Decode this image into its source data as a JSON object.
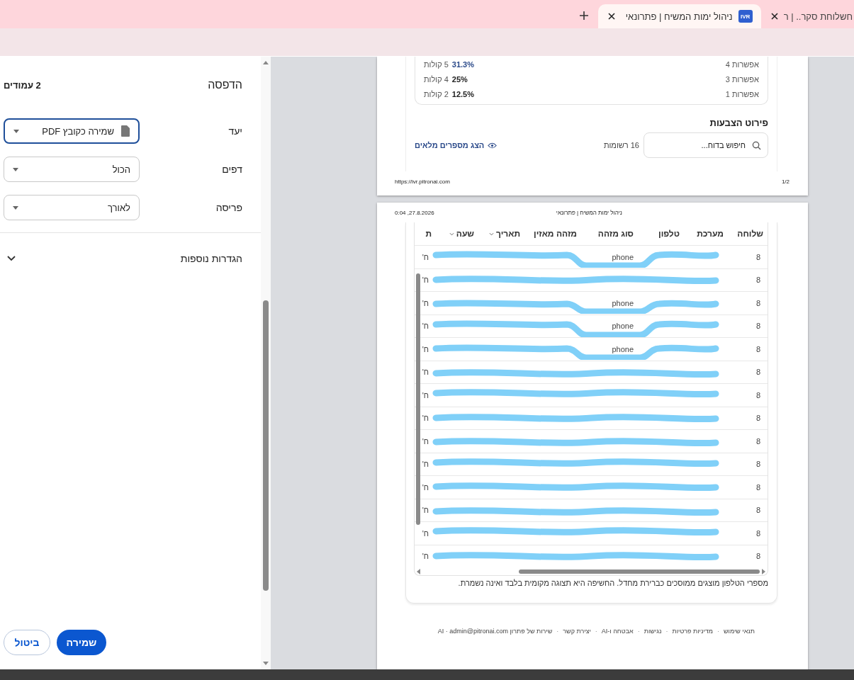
{
  "browser": {
    "tabs": [
      {
        "title": "חשלוחת סקר.. | ר",
        "selected": false
      },
      {
        "title": "ניהול ימות המשיח | פתרונאי",
        "favicon": "IVR",
        "selected": true
      }
    ]
  },
  "print_dialog": {
    "title": "הדפסה",
    "page_count": "2 עמודים",
    "settings": [
      {
        "label": "יעד",
        "value": "שמירה כקובץ PDF",
        "kind": "file",
        "focused": true
      },
      {
        "label": "דפים",
        "value": "הכול",
        "kind": "plain",
        "focused": false
      },
      {
        "label": "פריסה",
        "value": "לאורך",
        "kind": "plain",
        "focused": false
      }
    ],
    "more_settings": {
      "label": "הגדרות נוספות",
      "expanded": false
    },
    "buttons": [
      {
        "label": "שמירה",
        "kind": "primary"
      },
      {
        "label": "ביטול",
        "kind": "secondary"
      }
    ]
  },
  "preview": {
    "page_1": {
      "options": [
        {
          "label": "אפשרות 4",
          "percent": "31.3%",
          "votes": "5 קולות",
          "leading": true
        },
        {
          "label": "אפשרות 3",
          "percent": "25%",
          "votes": "4 קולות",
          "leading": false
        },
        {
          "label": "אפשרות 1",
          "percent": "12.5%",
          "votes": "2 קולות",
          "leading": false
        }
      ],
      "section_title": "פירוט הצבעות",
      "search_placeholder": "חיפוש בדוח...",
      "record_count": "16 רשומות",
      "reveal_link": "הצג מספרים מלאים",
      "footer_url": "https://ivr.pitronai.com",
      "page_number": "1/2"
    },
    "page_2": {
      "header_datetime": "0:04 ,27.8.2026",
      "header_title": "ניהול ימות המשיח | פתרונאי",
      "columns": [
        {
          "label": "שלוחה",
          "sortable": false
        },
        {
          "label": "מערכת",
          "sortable": false
        },
        {
          "label": "טלפון",
          "sortable": false
        },
        {
          "label": "סוג מזהה",
          "sortable": false
        },
        {
          "label": "מזהה מאזין",
          "sortable": false
        },
        {
          "label": "תאריך",
          "sortable": true
        },
        {
          "label": "שעה",
          "sortable": true
        },
        {
          "label": "ת",
          "sortable": false
        }
      ],
      "rows": [
        {
          "sender": "8",
          "id_type": "phone",
          "column_8": "ח'"
        },
        {
          "sender": "8",
          "column_8": "ח'"
        },
        {
          "sender": "8",
          "id_type": "phone",
          "column_8": "ח'"
        },
        {
          "sender": "8",
          "id_type": "phone",
          "column_8": "ח'"
        },
        {
          "sender": "8",
          "id_type": "phone",
          "column_8": "ח'"
        },
        {
          "sender": "8",
          "column_8": "ח'"
        },
        {
          "sender": "8",
          "column_8": "ח'"
        },
        {
          "sender": "8",
          "column_8": "ח'"
        },
        {
          "sender": "8",
          "column_8": "ח'"
        },
        {
          "sender": "8",
          "column_8": "ח'"
        },
        {
          "sender": "8",
          "column_8": "ח'"
        },
        {
          "sender": "8",
          "column_8": "ח'"
        },
        {
          "sender": "8",
          "column_8": "ח'"
        },
        {
          "sender": "8",
          "column_8": "ח'"
        }
      ],
      "note": "מספרי הטלפון מוצגים ממוסכים כברירת מחדל. החשיפה היא תצוגה מקומית בלבד ואינה נשמרת.",
      "link_separator": "·",
      "footer_links": [
        "תנאי שימוש",
        "מדיניות פרטיות",
        "נגישות",
        "אבטחה ו-AI",
        "יצירת קשר",
        "שירות של פתרון AI · admin@pitronai.com"
      ]
    }
  }
}
